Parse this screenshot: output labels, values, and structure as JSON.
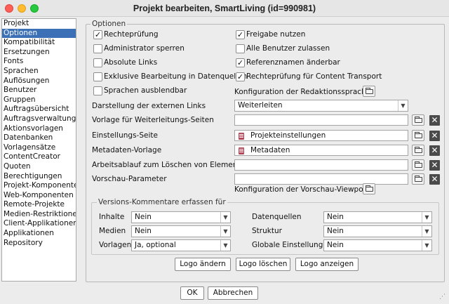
{
  "window": {
    "title": "Projekt bearbeiten, SmartLiving (id=990981)"
  },
  "sidebar": {
    "items": [
      "Projekt",
      "Optionen",
      "Kompatibilität",
      "Ersetzungen",
      "Fonts",
      "Sprachen",
      "Auflösungen",
      "Benutzer",
      "Gruppen",
      "Auftragsübersicht",
      "Auftragsverwaltung",
      "Aktionsvorlagen",
      "Datenbanken",
      "Vorlagensätze",
      "ContentCreator",
      "Quoten",
      "Berechtigungen",
      "Projekt-Komponenten",
      "Web-Komponenten",
      "Remote-Projekte",
      "Medien-Restriktionen",
      "Client-Applikationen",
      "Applikationen",
      "Repository"
    ],
    "selected_index": 1
  },
  "options": {
    "group_label": "Optionen",
    "checkboxes": [
      {
        "label": "Rechteprüfung",
        "checked": true
      },
      {
        "label": "Freigabe nutzen",
        "checked": true
      },
      {
        "label": "Administrator sperren",
        "checked": false
      },
      {
        "label": "Alle Benutzer zulassen",
        "checked": false
      },
      {
        "label": "Absolute Links",
        "checked": false
      },
      {
        "label": "Referenznamen änderbar",
        "checked": true
      },
      {
        "label": "Exklusive Bearbeitung in Datenquellen",
        "checked": false
      },
      {
        "label": "Rechteprüfung für Content Transport",
        "checked": true
      },
      {
        "label": "Sprachen ausblendbar",
        "checked": false
      }
    ],
    "lang_config_label": "Konfiguration der Redaktionssprachen",
    "link_display": {
      "label": "Darstellung der externen Links",
      "value": "Weiterleiten"
    },
    "fields": [
      {
        "label": "Vorlage für Weiterleitungs-Seiten",
        "value": "",
        "has_doc_icon": false
      },
      {
        "label": "Einstellungs-Seite",
        "value": "Projekteinstellungen",
        "has_doc_icon": true
      },
      {
        "label": "Metadaten-Vorlage",
        "value": "Metadaten",
        "has_doc_icon": true
      },
      {
        "label": "Arbeitsablauf zum Löschen von Elementen",
        "value": "",
        "has_doc_icon": false
      },
      {
        "label": "Vorschau-Parameter",
        "value": "",
        "has_doc_icon": false
      }
    ],
    "viewport_config_label": "Konfiguration der Vorschau-Viewports"
  },
  "versions": {
    "group_label": "Versions-Kommentare erfassen für",
    "rows": [
      {
        "left_label": "Inhalte",
        "left_value": "Nein",
        "right_label": "Datenquellen",
        "right_value": "Nein"
      },
      {
        "left_label": "Medien",
        "left_value": "Nein",
        "right_label": "Struktur",
        "right_value": "Nein"
      },
      {
        "left_label": "Vorlagen",
        "left_value": "Ja, optional",
        "right_label": "Globale Einstellungen",
        "right_value": "Nein"
      }
    ]
  },
  "logo_buttons": {
    "change": "Logo ändern",
    "delete": "Logo löschen",
    "show": "Logo anzeigen"
  },
  "footer": {
    "ok": "OK",
    "cancel": "Abbrechen"
  }
}
